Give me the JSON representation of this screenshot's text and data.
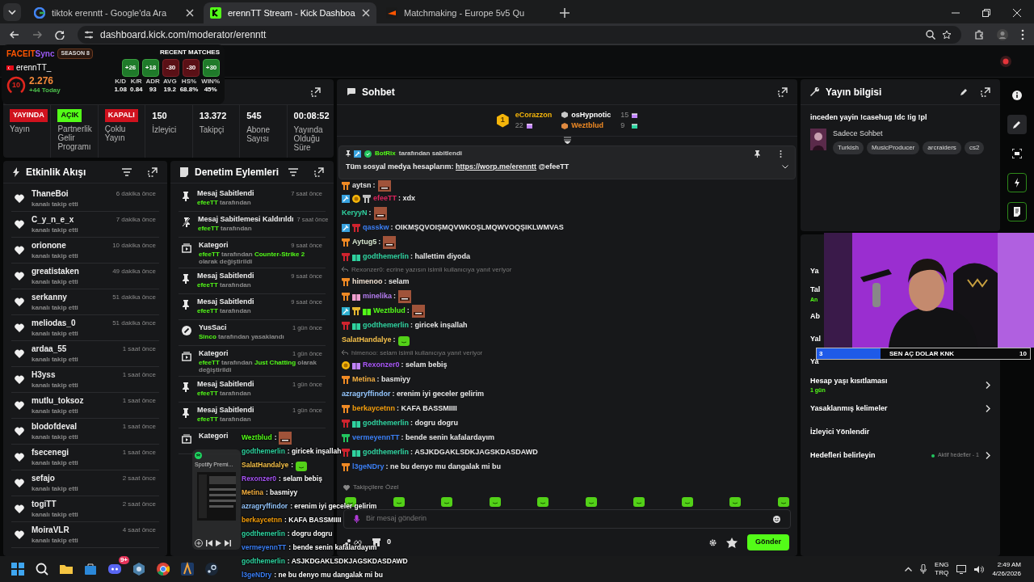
{
  "browser": {
    "tabs": [
      {
        "title": "tiktok erenntt - Google'da Ara",
        "kind": "google",
        "selected": false
      },
      {
        "title": "erennTT Stream - Kick Dashboa",
        "kind": "kick",
        "selected": true
      },
      {
        "title": "Matchmaking - Europe 5v5 Qu",
        "kind": "faceit",
        "selected": false
      }
    ],
    "url": "dashboard.kick.com/moderator/erenntt"
  },
  "faceit": {
    "brand": "FACEIT",
    "brand_suffix": "Sync",
    "season": "SEASON 8",
    "player": "erennTT_",
    "level": "10",
    "elo": "2.276",
    "today": "+44 Today",
    "recent_title": "RECENT MATCHES",
    "matches": [
      {
        "score": "+26",
        "win": true
      },
      {
        "score": "+18",
        "win": true
      },
      {
        "score": "-30",
        "win": false
      },
      {
        "score": "-30",
        "win": false
      },
      {
        "score": "+30",
        "win": true
      }
    ],
    "stats": [
      {
        "label": "K/D",
        "value": "1.08"
      },
      {
        "label": "K/R",
        "value": "0.84"
      },
      {
        "label": "ADR",
        "value": "93"
      },
      {
        "label": "AVG",
        "value": "19.2"
      },
      {
        "label": "HS%",
        "value": "68.8%"
      },
      {
        "label": "WIN%",
        "value": "45%"
      }
    ]
  },
  "stats": [
    {
      "badge": "YAYINDA",
      "on": false,
      "label": "Yayın"
    },
    {
      "badge": "AÇIK",
      "on": true,
      "label": "Partnerlik Gelir Programı"
    },
    {
      "badge": "KAPALI",
      "on": false,
      "label": "Çoklu Yayın"
    },
    {
      "value": "150",
      "label": "İzleyici"
    },
    {
      "value": "13.372",
      "label": "Takipçi"
    },
    {
      "value": "545",
      "label": "Abone Sayısı"
    },
    {
      "value": "00:08:52",
      "label": "Yayında Olduğu Süre"
    }
  ],
  "activity": {
    "title": "Etkinlik Akışı",
    "items": [
      {
        "user": "ThaneBoi",
        "time": "6 dakika önce",
        "action": "kanalı takip etti"
      },
      {
        "user": "C_y_n_e_x",
        "time": "7 dakika önce",
        "action": "kanalı takip etti"
      },
      {
        "user": "orionone",
        "time": "10 dakika önce",
        "action": "kanalı takip etti"
      },
      {
        "user": "greatistaken",
        "time": "49 dakika önce",
        "action": "kanalı takip etti"
      },
      {
        "user": "serkanny",
        "time": "51 dakika önce",
        "action": "kanalı takip etti"
      },
      {
        "user": "meliodas_0",
        "time": "51 dakika önce",
        "action": "kanalı takip etti"
      },
      {
        "user": "ardaa_55",
        "time": "1 saat önce",
        "action": "kanalı takip etti"
      },
      {
        "user": "H3yss",
        "time": "1 saat önce",
        "action": "kanalı takip etti"
      },
      {
        "user": "mutlu_toksoz",
        "time": "1 saat önce",
        "action": "kanalı takip etti"
      },
      {
        "user": "blodofdeval",
        "time": "1 saat önce",
        "action": "kanalı takip etti"
      },
      {
        "user": "fsecenegi",
        "time": "1 saat önce",
        "action": "kanalı takip etti"
      },
      {
        "user": "sefajo",
        "time": "2 saat önce",
        "action": "kanalı takip etti"
      },
      {
        "user": "togiTT",
        "time": "2 saat önce",
        "action": "kanalı takip etti"
      },
      {
        "user": "MoiraVLR",
        "time": "4 saat önce",
        "action": "kanalı takip etti"
      }
    ]
  },
  "moderation": {
    "title": "Denetim Eylemleri",
    "items": [
      {
        "kind": "pin",
        "title": "Mesaj Sabitlendi",
        "time": "7 saat önce",
        "segments": [
          {
            "text": "efeeTT",
            "green": true
          },
          {
            "text": "tarafından",
            "green": false
          }
        ]
      },
      {
        "kind": "unpin",
        "title": "Mesaj Sabitlemesi Kaldırıldı",
        "time": "7 saat önce",
        "segments": [
          {
            "text": "efeeTT",
            "green": true
          },
          {
            "text": "tarafından",
            "green": false
          }
        ]
      },
      {
        "kind": "category",
        "title": "Kategori",
        "time": "9 saat önce",
        "segments": [
          {
            "text": "efeeTT",
            "green": true
          },
          {
            "text": "tarafından",
            "green": false
          },
          {
            "text": "Counter-Strike 2",
            "green": true
          },
          {
            "text": "olarak değiştirildi",
            "green": false
          }
        ]
      },
      {
        "kind": "pin",
        "title": "Mesaj Sabitlendi",
        "time": "9 saat önce",
        "segments": [
          {
            "text": "efeeTT",
            "green": true
          },
          {
            "text": "tarafından",
            "green": false
          }
        ]
      },
      {
        "kind": "pin",
        "title": "Mesaj Sabitlendi",
        "time": "9 saat önce",
        "segments": [
          {
            "text": "efeeTT",
            "green": true
          },
          {
            "text": "tarafından",
            "green": false
          }
        ]
      },
      {
        "kind": "ban",
        "title": "YusSaci",
        "time": "1 gün önce",
        "segments": [
          {
            "text": "Sinco",
            "green": true
          },
          {
            "text": "tarafından yasaklandı",
            "green": false
          }
        ]
      },
      {
        "kind": "category",
        "title": "Kategori",
        "time": "1 gün önce",
        "segments": [
          {
            "text": "efeeTT",
            "green": true
          },
          {
            "text": "tarafından",
            "green": false
          },
          {
            "text": "Just Chatting",
            "green": true
          },
          {
            "text": "olarak değiştirildi",
            "green": false
          }
        ]
      },
      {
        "kind": "pin",
        "title": "Mesaj Sabitlendi",
        "time": "1 gün önce",
        "segments": [
          {
            "text": "efeeTT",
            "green": true
          },
          {
            "text": "tarafından",
            "green": false
          }
        ]
      },
      {
        "kind": "pin",
        "title": "Mesaj Sabitlendi",
        "time": "1 gün önce",
        "segments": [
          {
            "text": "efeeTT",
            "green": true
          },
          {
            "text": "tarafından",
            "green": false
          }
        ]
      },
      {
        "kind": "category",
        "title": "Kategori"
      }
    ]
  },
  "chat": {
    "title": "Sohbet",
    "gifters": [
      {
        "rank": "1",
        "name": "eCorazzon",
        "count": "22"
      },
      {
        "name": "osHypnotic",
        "count": "15"
      },
      {
        "name": "Weztblud",
        "count": "9"
      }
    ],
    "pinned": {
      "by": "BotRix",
      "note": "tarafından sabitlendi",
      "text": "Tüm sosyal medya hesaplarım:",
      "link": "https://worp.me/erenntt",
      "mention": "@efeeTT"
    },
    "messages": [
      {
        "kind": "face_emote",
        "user": "aytsn",
        "color": "#e5e5e5",
        "text": ":",
        "badges": [
          {
            "kind": "sub",
            "color": "#f08a24"
          }
        ]
      },
      {
        "kind": "text",
        "user": "efeeTT",
        "color": "#e0245e",
        "text": ": xdx",
        "badges": [
          {
            "kind": "mod",
            "color": "#38a3e0"
          },
          {
            "kind": "coin",
            "color": "#f5b50a"
          },
          {
            "kind": "sub",
            "color": "#c0c0c0"
          }
        ]
      },
      {
        "kind": "face_emote",
        "user": "KeryyN",
        "color": "#2fd3a0",
        "text": ":"
      },
      {
        "kind": "text",
        "user": "qasskw",
        "color": "#3b7ff5",
        "text": ": OIKMŞQVOIŞMQVWKOŞLMQWVOQŞIKLWMVAS",
        "badges": [
          {
            "kind": "mod",
            "color": "#38a3e0"
          },
          {
            "kind": "sub",
            "color": "#d0232e"
          }
        ]
      },
      {
        "kind": "face_emote",
        "user": "Aytug5",
        "color": "#d6e6cf",
        "text": ":",
        "badges": [
          {
            "kind": "sub",
            "color": "#f08a24"
          }
        ]
      },
      {
        "kind": "text",
        "user": "godthemerlin",
        "color": "#2fd3a0",
        "text": ": hallettim diyoda",
        "badges": [
          {
            "kind": "sub",
            "color": "#d0232e"
          },
          {
            "kind": "gift",
            "color": "#2fd3a0"
          }
        ]
      },
      {
        "kind": "reply",
        "text": "Rexonzer0: ecrine yazısın isimli kullanıcıya yanıt veriyor"
      },
      {
        "kind": "text",
        "user": "himenoo",
        "color": "#f0e0d0",
        "text": ": selam",
        "badges": [
          {
            "kind": "sub",
            "color": "#f08a24"
          }
        ]
      },
      {
        "kind": "face_emote",
        "user": "minelika",
        "color": "#b57cf0",
        "text": ":",
        "badges": [
          {
            "kind": "sub",
            "color": "#f08a24"
          },
          {
            "kind": "gift",
            "color": "#f0a0d0"
          }
        ]
      },
      {
        "kind": "face_emote",
        "user": "Weztblud",
        "color": "#53fc18",
        "text": ":",
        "badges": [
          {
            "kind": "mod",
            "color": "#2fb0d0"
          },
          {
            "kind": "sub",
            "color": "#e8b830"
          },
          {
            "kind": "gift",
            "color": "#53fc18"
          }
        ]
      },
      {
        "kind": "text",
        "user": "godthemerlin",
        "color": "#2fd3a0",
        "text": ": giricek inşallah",
        "badges": [
          {
            "kind": "sub",
            "color": "#d0232e"
          },
          {
            "kind": "gift",
            "color": "#2fd3a0"
          }
        ]
      },
      {
        "kind": "blob_emote",
        "user": "SalatHandalye",
        "color": "#f5c04a",
        "text": ":"
      },
      {
        "kind": "reply",
        "text": "himenoo: selam isimli kullanıcıya yanıt veriyor"
      },
      {
        "kind": "text",
        "user": "Rexonzer0",
        "color": "#a855f7",
        "text": ": selam bebiş",
        "badges": [
          {
            "kind": "coin",
            "color": "#f5b50a"
          },
          {
            "kind": "gift",
            "color": "#c084fc"
          }
        ]
      },
      {
        "kind": "text",
        "user": "Metina",
        "color": "#f5b041",
        "text": ": basmiyy",
        "badges": [
          {
            "kind": "sub",
            "color": "#f08a24"
          }
        ]
      },
      {
        "kind": "text",
        "user": "azragryffindor",
        "color": "#93c5fd",
        "text": ": erenim iyi geceler gelirim"
      },
      {
        "kind": "text",
        "user": "berkaycetnn",
        "color": "#f59e0b",
        "text": ": KAFA BASSMIIII",
        "badges": [
          {
            "kind": "sub",
            "color": "#f08a24"
          }
        ]
      },
      {
        "kind": "text",
        "user": "godthemerlin",
        "color": "#2fd3a0",
        "text": ": dogru dogru",
        "badges": [
          {
            "kind": "sub",
            "color": "#d0232e"
          },
          {
            "kind": "gift",
            "color": "#2fd3a0"
          }
        ]
      },
      {
        "kind": "text",
        "user": "vermeyennTT",
        "color": "#3b7ff5",
        "text": ": bende senin kafalardayım",
        "badges": [
          {
            "kind": "sub",
            "color": "#22c55e"
          }
        ]
      },
      {
        "kind": "text",
        "user": "godthemerlin",
        "color": "#2fd3a0",
        "text": ": ASJKDGAKLSDKJAGSKDASDAWD",
        "badges": [
          {
            "kind": "sub",
            "color": "#d0232e"
          },
          {
            "kind": "gift",
            "color": "#2fd3a0"
          }
        ]
      },
      {
        "kind": "text",
        "user": "l3geNDry",
        "color": "#3b7ff5",
        "text": ": ne bu denyo mu dangalak mi bu",
        "badges": [
          {
            "kind": "sub",
            "color": "#f08a24"
          }
        ]
      }
    ],
    "emote_section": "Takipçilere Özel",
    "input": {
      "placeholder": "Bir mesaj gönderin"
    },
    "points": "0",
    "send": "Gönder"
  },
  "stream_info": {
    "title": "Yayın bilgisi",
    "stream_title": "inceden yayin !casehug !dc !ig !pl",
    "category": "Sadece Sohbet",
    "tags": [
      "Turkish",
      "MusicProducer",
      "arcraiders",
      "cs2"
    ]
  },
  "channel_actions": {
    "fragments": [
      "Ya",
      "Tal",
      "Ab",
      "Yal",
      "Ya"
    ],
    "fragment_note": "An",
    "items": [
      {
        "label": "Hesap yaşı kısıtlaması",
        "value": "1 gün",
        "arrow": true
      },
      {
        "label": "Yasaklanmış kelimeler",
        "arrow": true
      },
      {
        "label": "İzleyici Yönlendir",
        "arrow": false
      },
      {
        "label": "Hedefleri belirleyin",
        "status": "Aktif hedefler - 1",
        "arrow": true
      }
    ]
  },
  "rail": [
    {
      "kind": "info",
      "selected": false
    },
    {
      "kind": "pencil",
      "selected": true
    },
    {
      "kind": "capture",
      "selected": false
    },
    {
      "kind": "bolt",
      "selected": false
    },
    {
      "kind": "doc",
      "selected": false
    }
  ],
  "goal": {
    "start": "3",
    "text": "SEN AÇ DOLAR KNK",
    "end": "10",
    "level": 0.3
  },
  "overlay_chat": [
    {
      "user": "Weztblud",
      "color": "#53fc18",
      "kind": "face_emote",
      "text": ":"
    },
    {
      "user": "godthemerlin",
      "color": "#2fd3a0",
      "text": ": giricek inşallah"
    },
    {
      "user": "SalatHandalye",
      "color": "#f5c04a",
      "kind": "blob_emote",
      "text": ":"
    },
    {
      "user": "Rexonzer0",
      "color": "#a855f7",
      "text": ": selam bebiş"
    },
    {
      "user": "Metina",
      "color": "#f5b041",
      "text": ": basmiyy"
    },
    {
      "user": "azragryffindor",
      "color": "#93c5fd",
      "text": ": erenim iyi geceler gelirim"
    },
    {
      "user": "berkaycetnn",
      "color": "#f59e0b",
      "text": ": KAFA BASSMIIII"
    },
    {
      "user": "godthemerlin",
      "color": "#2fd3a0",
      "text": ": dogru dogru"
    },
    {
      "user": "vermeyennTT",
      "color": "#3b7ff5",
      "text": ": bende senin kafalardayım"
    },
    {
      "user": "godthemerlin",
      "color": "#2fd3a0",
      "text": ": ASJKDGAKLSDKJAGSKDASDAWD"
    },
    {
      "user": "l3geNDry",
      "color": "#3b7ff5",
      "text": ": ne bu denyo mu dangalak mi bu"
    }
  ],
  "spotify": {
    "title": "Spotify Premi..."
  },
  "taskbar": {
    "apps": [
      {
        "kind": "start"
      },
      {
        "kind": "search"
      },
      {
        "kind": "folder"
      },
      {
        "kind": "store"
      },
      {
        "kind": "discord",
        "badge": "9+"
      },
      {
        "kind": "app"
      },
      {
        "kind": "chrome"
      },
      {
        "kind": "game"
      },
      {
        "kind": "steam"
      }
    ],
    "lang": "ENG",
    "layout": "TRQ",
    "time": "2:49 AM",
    "date": "4/26/2026"
  }
}
